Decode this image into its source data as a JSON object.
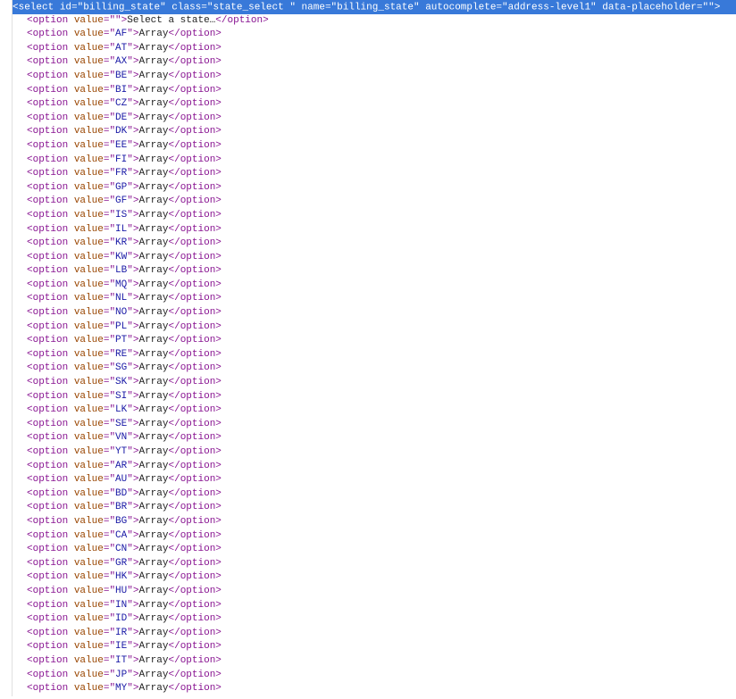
{
  "select_tag": {
    "tag": "select",
    "attrs": [
      {
        "name": "id",
        "value": "billing_state"
      },
      {
        "name": "class",
        "value": "state_select "
      },
      {
        "name": "name",
        "value": "billing_state"
      },
      {
        "name": "autocomplete",
        "value": "address-level1"
      },
      {
        "name": "data-placeholder",
        "value": ""
      }
    ]
  },
  "first_option": {
    "tag": "option",
    "value_attr": "",
    "text": "Select a state…"
  },
  "option_tag_name": "option",
  "option_attr_name": "value",
  "option_text": "Array",
  "option_values": [
    "AF",
    "AT",
    "AX",
    "BE",
    "BI",
    "CZ",
    "DE",
    "DK",
    "EE",
    "FI",
    "FR",
    "GP",
    "GF",
    "IS",
    "IL",
    "KR",
    "KW",
    "LB",
    "MQ",
    "NL",
    "NO",
    "PL",
    "PT",
    "RE",
    "SG",
    "SK",
    "SI",
    "LK",
    "SE",
    "VN",
    "YT",
    "AR",
    "AU",
    "BD",
    "BR",
    "BG",
    "CA",
    "CN",
    "GR",
    "HK",
    "HU",
    "IN",
    "ID",
    "IR",
    "IE",
    "IT",
    "JP",
    "MY"
  ],
  "toggle_glyph": "▼"
}
